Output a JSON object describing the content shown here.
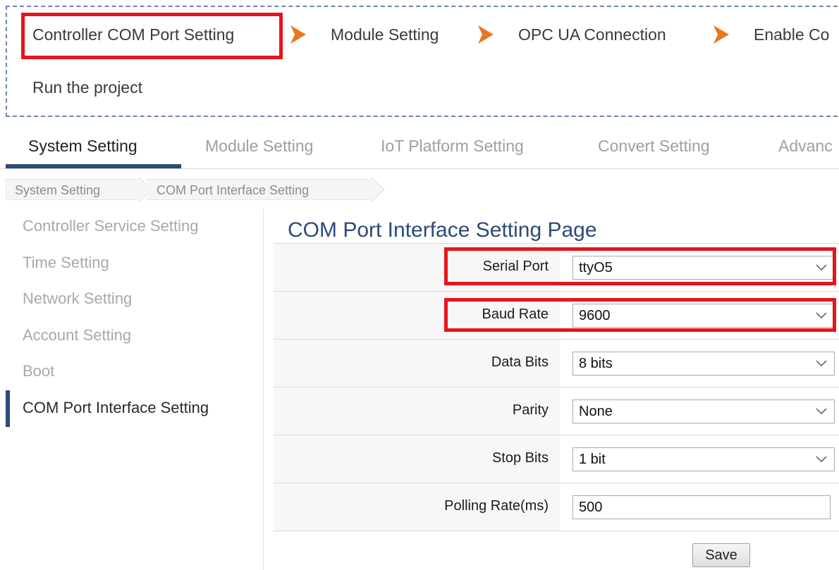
{
  "wizard": {
    "steps": [
      "Controller COM Port Setting",
      "Module Setting",
      "OPC UA Connection",
      "Enable Co",
      "Run the project"
    ],
    "arrow_icon": "chevron-right-arrow-icon",
    "arrow_color": "#e87722",
    "highlight_color": "#e8141c"
  },
  "tabs": [
    {
      "label": "System Setting",
      "active": true
    },
    {
      "label": "Module Setting",
      "active": false
    },
    {
      "label": "IoT Platform Setting",
      "active": false
    },
    {
      "label": "Convert Setting",
      "active": false
    },
    {
      "label": "Advanc",
      "active": false
    }
  ],
  "breadcrumb": [
    "System Setting",
    "COM Port Interface Setting"
  ],
  "sidebar": {
    "items": [
      {
        "label": "Controller Service Setting",
        "active": false
      },
      {
        "label": "Time Setting",
        "active": false
      },
      {
        "label": "Network Setting",
        "active": false
      },
      {
        "label": "Account Setting",
        "active": false
      },
      {
        "label": "Boot",
        "active": false
      },
      {
        "label": "COM Port Interface Setting",
        "active": true
      }
    ]
  },
  "page": {
    "title": "COM Port Interface Setting Page"
  },
  "form": {
    "fields": [
      {
        "label": "Serial Port",
        "value": "ttyO5",
        "type": "select",
        "highlighted": true
      },
      {
        "label": "Baud Rate",
        "value": "9600",
        "type": "select",
        "highlighted": true
      },
      {
        "label": "Data Bits",
        "value": "8 bits",
        "type": "select",
        "highlighted": false
      },
      {
        "label": "Parity",
        "value": "None",
        "type": "select",
        "highlighted": false
      },
      {
        "label": "Stop Bits",
        "value": "1 bit",
        "type": "select",
        "highlighted": false
      },
      {
        "label": "Polling Rate(ms)",
        "value": "500",
        "type": "text",
        "highlighted": false
      }
    ],
    "save_label": "Save"
  },
  "colors": {
    "accent": "#2c4a7a",
    "inactive_text": "#9aa0a8"
  }
}
